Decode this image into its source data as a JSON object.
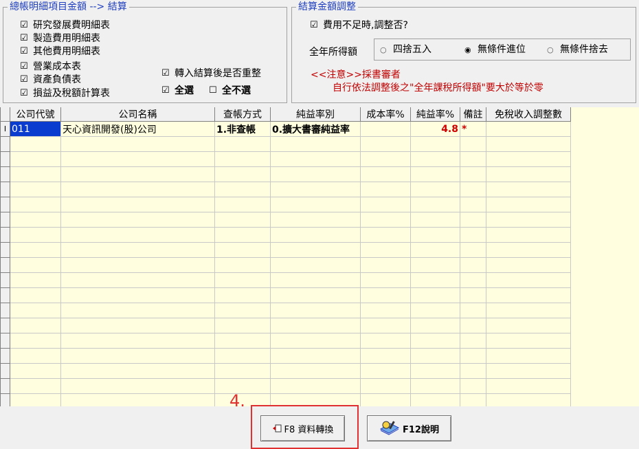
{
  "left_group": {
    "title": "總帳明細項目金額 --> 結算",
    "items": [
      {
        "label": "研究發展費明細表",
        "checked": true
      },
      {
        "label": "製造費用明細表",
        "checked": true
      },
      {
        "label": "其他費用明細表",
        "checked": true
      },
      {
        "label": "營業成本表",
        "checked": true
      },
      {
        "label": "資產負債表",
        "checked": true
      },
      {
        "label": "損益及稅額計算表",
        "checked": true
      }
    ],
    "transfer_label": "轉入結算後是否重整",
    "select_all_label": "全選",
    "select_none_label": "全不選"
  },
  "right_group": {
    "title": "結算金額調整",
    "adjust_label": "費用不足時,調整否?",
    "income_label": "全年所得額",
    "radios": [
      {
        "label": "四捨五入",
        "selected": false
      },
      {
        "label": "無條件進位",
        "selected": true
      },
      {
        "label": "無條件捨去",
        "selected": false
      }
    ],
    "notice_line1": "<<注意>>採書審者",
    "notice_line2": "自行依法調整後之\"全年課稅所得額\"要大於等於零"
  },
  "grid": {
    "columns": [
      "公司代號",
      "公司名稱",
      "查帳方式",
      "純益率別",
      "成本率%",
      "純益率%",
      "備註",
      "免稅收入調整數"
    ],
    "rows": [
      {
        "indicator": "I",
        "code": "011",
        "name": "天心資訊開發(股)公司",
        "audit": "1.非查帳",
        "profit_type": "0.擴大書審純益率",
        "cost_rate": "",
        "profit_rate": "4.8",
        "note": "*",
        "exempt": ""
      }
    ]
  },
  "footer": {
    "step_label": "4.",
    "convert_button": "F8 資料轉換",
    "help_button": "F12說明"
  },
  "colors": {
    "accent": "#1f3fbf",
    "selection": "#0a3ccf",
    "warning": "#c00000",
    "callout": "#e03030",
    "grid_bg": "#ffffe0"
  }
}
